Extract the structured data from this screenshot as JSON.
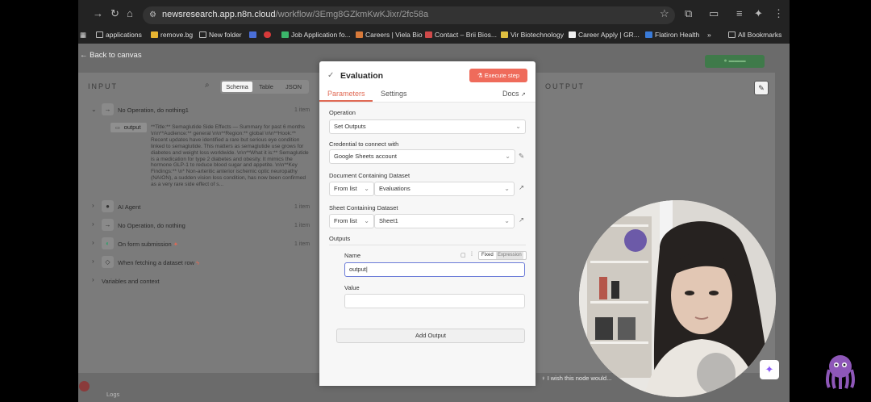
{
  "browser": {
    "url_host": "newsresearch.app.n8n.cloud",
    "url_path": "/workflow/3Emg8GZkmKwKJixr/2fc58a",
    "bookmarks": [
      {
        "label": "applications",
        "color": "#bbbbbb"
      },
      {
        "label": "remove.bg",
        "color": "#e8b531"
      },
      {
        "label": "New folder",
        "color": "#bbbbbb"
      },
      {
        "label": "",
        "color": "#4a6fd8"
      },
      {
        "label": "",
        "color": "#d83a3a"
      },
      {
        "label": "Job Application fo...",
        "color": "#3bb56a"
      },
      {
        "label": "Careers | Viela Bio",
        "color": "#d87a3a"
      },
      {
        "label": "Contact – Brii Bios...",
        "color": "#cf4a4a"
      },
      {
        "label": "Vir Biotechnology",
        "color": "#e0c040"
      },
      {
        "label": "Career Apply | GR...",
        "color": "#f0f0f0"
      },
      {
        "label": "Flatiron Health",
        "color": "#3a7bd8"
      },
      {
        "label": "»",
        "color": ""
      },
      {
        "label": "All Bookmarks",
        "color": "#bbbbbb"
      }
    ]
  },
  "canvas": {
    "back_label": "Back to canvas"
  },
  "input_panel": {
    "title": "INPUT",
    "tabs": [
      "Schema",
      "Table",
      "JSON"
    ],
    "active_tab": "Schema",
    "rows": [
      {
        "label": "No Operation, do nothing1",
        "count": "1 item",
        "expanded": true,
        "icon": "→"
      },
      {
        "label": "AI Agent",
        "count": "1 item",
        "expanded": false,
        "icon": "●"
      },
      {
        "label": "No Operation, do nothing",
        "count": "1 item",
        "expanded": false,
        "icon": "→"
      },
      {
        "label": "On form submission",
        "count": "1 item",
        "expanded": false,
        "icon": "◐"
      },
      {
        "label": "When fetching a dataset row",
        "count": "",
        "expanded": false,
        "icon": "◇"
      }
    ],
    "variables_label": "Variables and context",
    "output_key": "output",
    "output_value": "**Title:** Semaglutide Side Effects — Summary for past 6 months \\n\\n**Audience:** general \\n\\n**Region:** global \\n\\n**Hook:** Recent updates have identified a rare but serious eye condition linked to semaglutide. This matters as semaglutide use grows for diabetes and weight loss worldwide. \\n\\n**What it is:** Semaglutide is a medication for type 2 diabetes and obesity. It mimics the hormone GLP-1 to reduce blood sugar and appetite. \\n\\n**Key Findings:** \\n* Non-arteritic anterior ischemic optic neuropathy (NAION), a sudden vision loss condition, has now been confirmed as a very rare side effect of s..."
  },
  "modal": {
    "title": "Evaluation",
    "execute_label": "Execute step",
    "tabs": {
      "parameters": "Parameters",
      "settings": "Settings",
      "docs": "Docs"
    },
    "operation_label": "Operation",
    "operation_value": "Set Outputs",
    "credential_label": "Credential to connect with",
    "credential_value": "Google Sheets account",
    "document_label": "Document Containing Dataset",
    "document_mode": "From list",
    "document_value": "Evaluations",
    "sheet_label": "Sheet Containing Dataset",
    "sheet_mode": "From list",
    "sheet_value": "Sheet1",
    "outputs_label": "Outputs",
    "name_label": "Name",
    "name_value": "output",
    "toggle_fixed": "Fixed",
    "toggle_expression": "Expression",
    "value_label": "Value",
    "value_value": "",
    "add_output_label": "Add Output"
  },
  "output_panel": {
    "title": "OUTPUT"
  },
  "footer": {
    "feedback_text": "I wish this node would...",
    "logs_label": "Logs"
  },
  "colors": {
    "accent": "#ef6b5b",
    "tab_active": "#e06a55"
  }
}
